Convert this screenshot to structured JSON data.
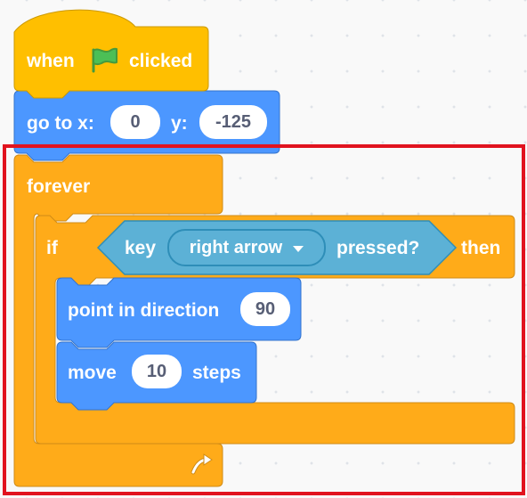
{
  "workspace": {
    "hat_block": {
      "when_label": "when",
      "icon": "green-flag-icon",
      "clicked_label": "clicked"
    },
    "goto_block": {
      "label": "go to x:",
      "x_value": "0",
      "y_label": "y:",
      "y_value": "-125"
    },
    "forever_block": {
      "label": "forever",
      "loop_icon": "loop-arrow-icon"
    },
    "if_block": {
      "if_label": "if",
      "then_label": "then",
      "condition": {
        "key_label": "key",
        "key_option": "right arrow",
        "pressed_label": "pressed?"
      }
    },
    "point_block": {
      "label": "point in direction",
      "value": "90"
    },
    "move_block": {
      "label": "move",
      "value": "10",
      "steps_label": "steps"
    }
  },
  "colors": {
    "events": "#ffbf00",
    "events_border": "#cc9900",
    "motion": "#4c97ff",
    "motion_border": "#3373cc",
    "control": "#ffab19",
    "control_border": "#cf8b17",
    "sensing": "#5cb1d6",
    "sensing_border": "#2e8eb8",
    "highlight": "#e1131f"
  }
}
